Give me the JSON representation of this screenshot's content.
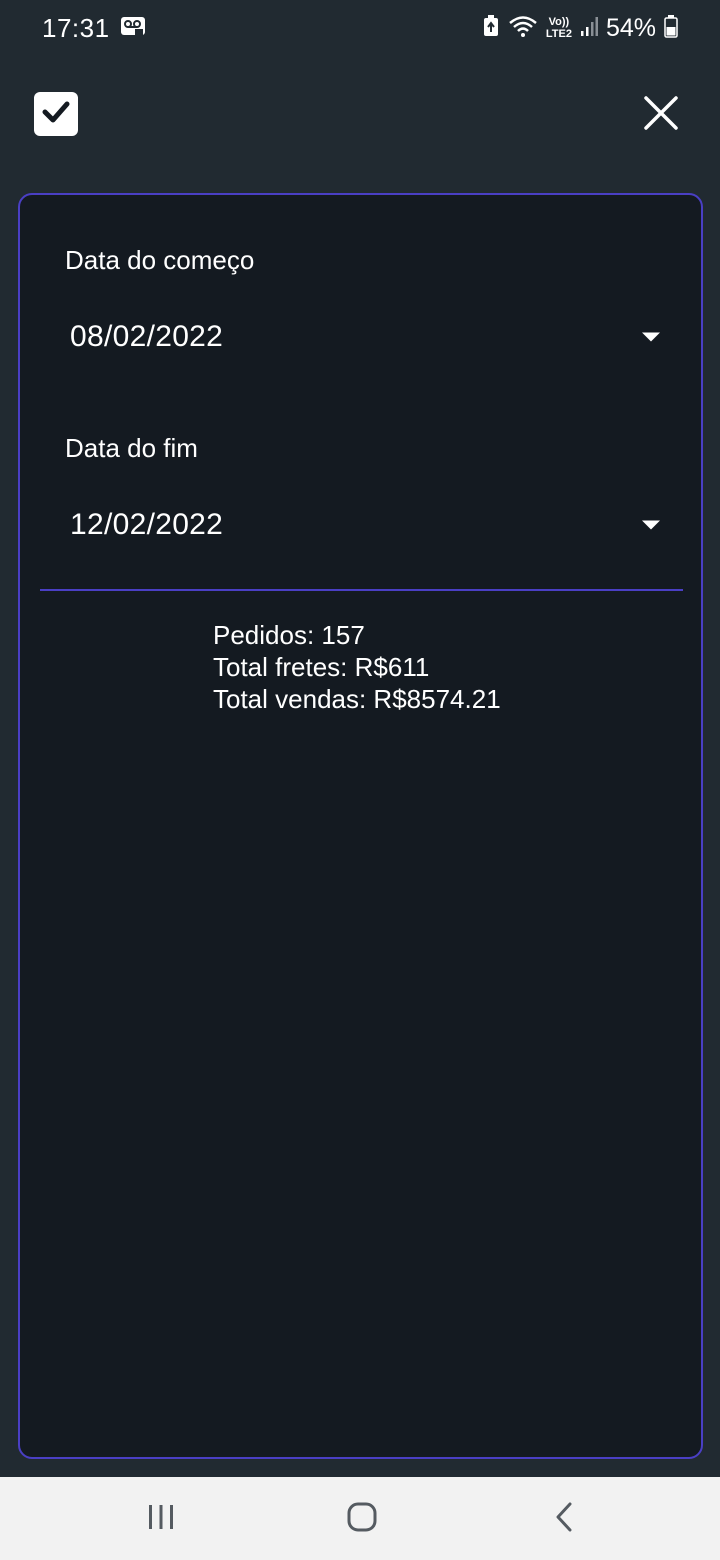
{
  "status_bar": {
    "time": "17:31",
    "battery_percent": "54%",
    "icons": [
      "voicemail-icon",
      "recycle-icon",
      "wifi-icon",
      "volte-lte2-icon",
      "signal-icon",
      "battery-icon"
    ],
    "network_label_top": "Vo))",
    "network_label_bottom": "LTE2"
  },
  "toolbar": {
    "confirm_icon": "checkbox-checked-icon",
    "close_icon": "close-icon"
  },
  "filter": {
    "start_label": "Data do começo",
    "start_value": "08/02/2022",
    "end_label": "Data do fim",
    "end_value": "12/02/2022"
  },
  "summary": {
    "orders": "Pedidos: 157",
    "shipping_total": "Total fretes: R$611",
    "sales_total": "Total vendas: R$8574.21"
  },
  "colors": {
    "background": "#212a31",
    "card": "#141a21",
    "accent": "#4a3fc4",
    "nav_bar": "#f2f2f2"
  },
  "nav_bar": {
    "icons": [
      "recent-apps-icon",
      "home-icon",
      "back-icon"
    ]
  }
}
